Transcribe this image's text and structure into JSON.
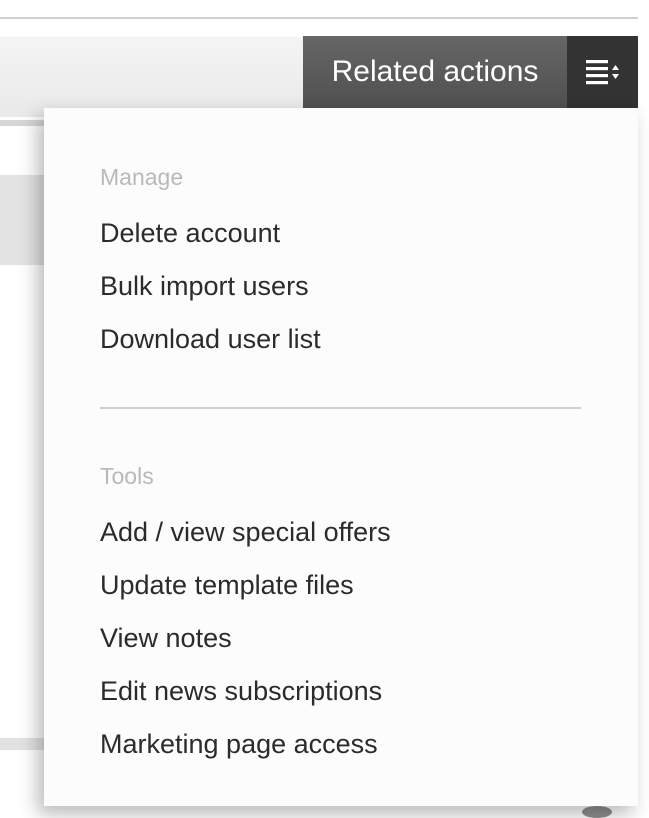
{
  "related_actions": {
    "label": "Related actions",
    "toggle_icon": "list-dropdown-icon"
  },
  "menu": {
    "sections": [
      {
        "heading": "Manage",
        "items": [
          "Delete account",
          "Bulk import users",
          "Download user list"
        ]
      },
      {
        "heading": "Tools",
        "items": [
          "Add / view special offers",
          "Update template files",
          "View notes",
          "Edit news subscriptions",
          "Marketing page access"
        ]
      }
    ]
  },
  "colors": {
    "button_bg": "#5a5a5a",
    "toggle_bg": "#333333",
    "menu_bg": "#fcfcfc",
    "heading_text": "#b9b9b9",
    "item_text": "#2b2b2b"
  }
}
